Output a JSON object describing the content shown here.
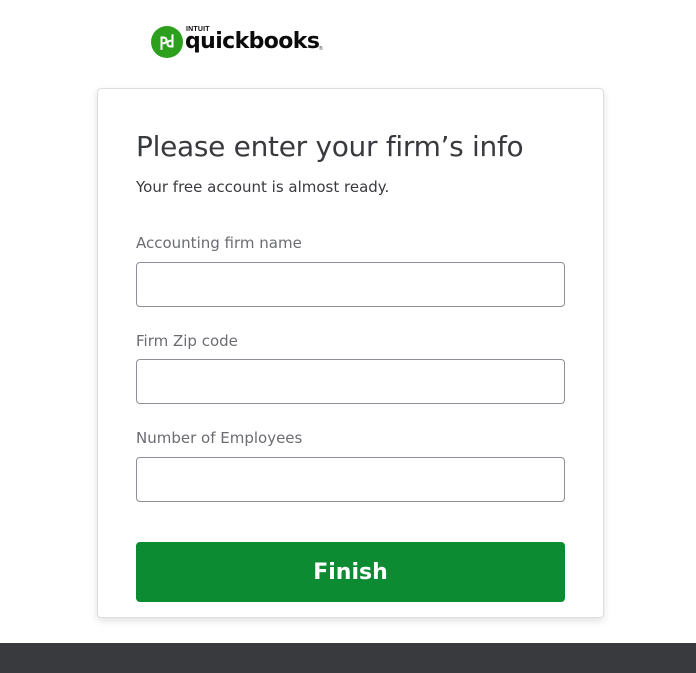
{
  "brand": {
    "name": "quickbooks",
    "parent": "INTUIT",
    "mark_glyph": "qb",
    "logo_icon": "quickbooks-logo-icon",
    "accent_color": "#2ca01c"
  },
  "form": {
    "title": "Please enter your firm’s info",
    "subtitle": "Your free account is almost ready.",
    "fields": [
      {
        "label": "Accounting firm name",
        "value": "",
        "placeholder": ""
      },
      {
        "label": "Firm Zip code",
        "value": "",
        "placeholder": ""
      },
      {
        "label": "Number of Employees",
        "value": "",
        "placeholder": ""
      }
    ],
    "submit_label": "Finish",
    "submit_color": "#0c8b33"
  },
  "footer": {
    "color": "#393a3d"
  }
}
